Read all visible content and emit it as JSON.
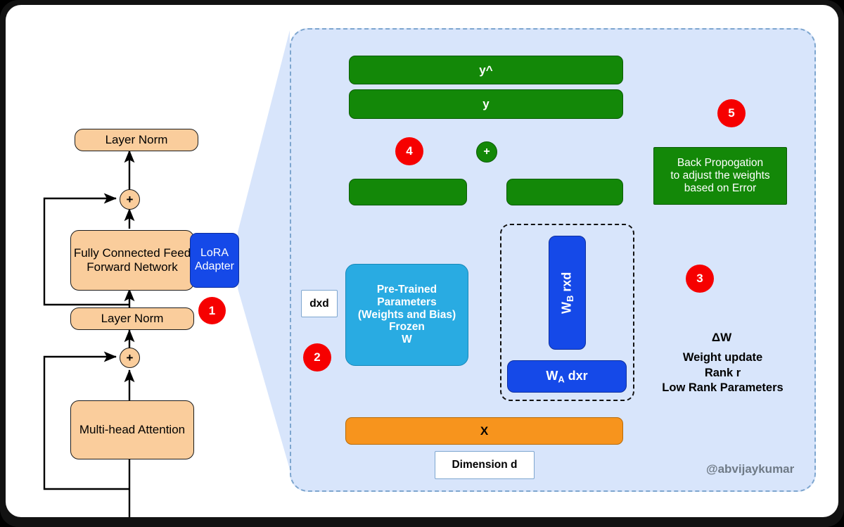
{
  "diagram": {
    "title": "LoRA Adapter in a Transformer Block",
    "watermark": "@abvijaykumar",
    "colors": {
      "panel_background": "#D8E5FB",
      "panel_border": "#7EA6CF",
      "transformer_block": "#FACD9C",
      "lora_blue": "#1549E8",
      "pretrained_cyan": "#29ABE2",
      "output_green": "#138808",
      "input_orange": "#F7941D",
      "badge_red": "#F60000",
      "canvas": "#FFFFFF",
      "frame": "#121212"
    }
  },
  "transformer": {
    "layer_norm_top": "Layer Norm",
    "add_top": "+",
    "ffn": "Fully Connected Feed\nForward Network",
    "lora_adapter": "LoRA\nAdapter",
    "layer_norm_mid": "Layer Norm",
    "add_mid": "+",
    "multi_head_attention": "Multi-head Attention"
  },
  "panel": {
    "y_hat": "y^",
    "y": "y",
    "sum": "+",
    "branch_left": "",
    "branch_right": "",
    "backprop": "Back Propogation\nto adjust the weights\nbased on Error",
    "pretrained": "Pre-Trained\nParameters\n(Weights and Bias)\nFrozen\nW",
    "dxd_label": "dxd",
    "w_b": "W<sub>B</sub> rxd",
    "w_a": "W<sub>A</sub> dxr",
    "input_x": "X",
    "dimension_label": "Dimension d",
    "delta_w": "ΔW",
    "delta_w_desc": "Weight update\nRank r\nLow Rank Parameters"
  },
  "badges": [
    {
      "id": "1",
      "label": "1"
    },
    {
      "id": "2",
      "label": "2"
    },
    {
      "id": "3",
      "label": "3"
    },
    {
      "id": "4",
      "label": "4"
    },
    {
      "id": "5",
      "label": "5"
    }
  ]
}
